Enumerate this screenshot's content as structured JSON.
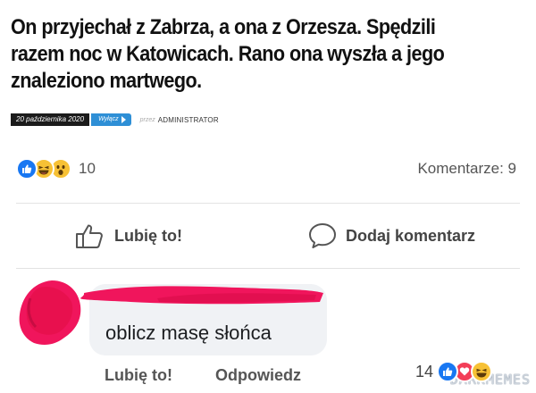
{
  "article": {
    "headline": "On przyjechał z Zabrza, a ona z Orzesza. Spędzili razem noc w Katowicach. Rano ona wyszła a jego znaleziono martwego.",
    "date": "20 października 2020",
    "category_label": "Wyłącz",
    "by_label": "przez",
    "author": "ADMINISTRATOR"
  },
  "reactions": {
    "icons": [
      "like-icon",
      "haha-icon",
      "wow-icon"
    ],
    "count": "10",
    "comments_label": "Komentarze: 9"
  },
  "actions": {
    "like_label": "Lubię to!",
    "comment_label": "Dodaj komentarz"
  },
  "comment": {
    "text": "oblicz masę słońca",
    "like_label": "Lubię to!",
    "reply_label": "Odpowiedz",
    "reaction_count": "14",
    "reaction_icons": [
      "like-icon",
      "love-icon",
      "haha-icon"
    ]
  },
  "watermark": "DARKMEMES",
  "colors": {
    "facebook_blue": "#1877f2",
    "redaction_pink": "#f0155c",
    "comment_bubble": "#f0f2f5"
  }
}
